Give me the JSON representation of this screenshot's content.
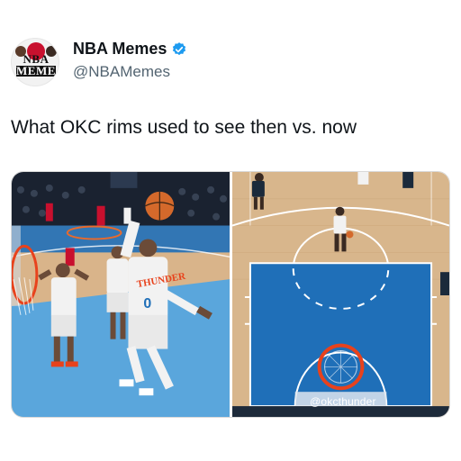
{
  "account": {
    "display_name": "NBA Memes",
    "handle": "@NBAMemes",
    "avatar_logo_line1": "NBA",
    "avatar_logo_line2": "MEMES",
    "verified": true,
    "verified_color": "#1d9bf0"
  },
  "tweet": {
    "text": "What OKC rims used to see then vs. now"
  },
  "media": {
    "left_panel": {
      "jersey_text": "THUNDER",
      "jersey_number": "0",
      "court_color": "#d9b48a",
      "paint_color": "#5aa6dc"
    },
    "right_panel": {
      "watermark": "@okcthunder",
      "court_color": "#d8b68c",
      "paint_color": "#1f6fb8"
    }
  }
}
